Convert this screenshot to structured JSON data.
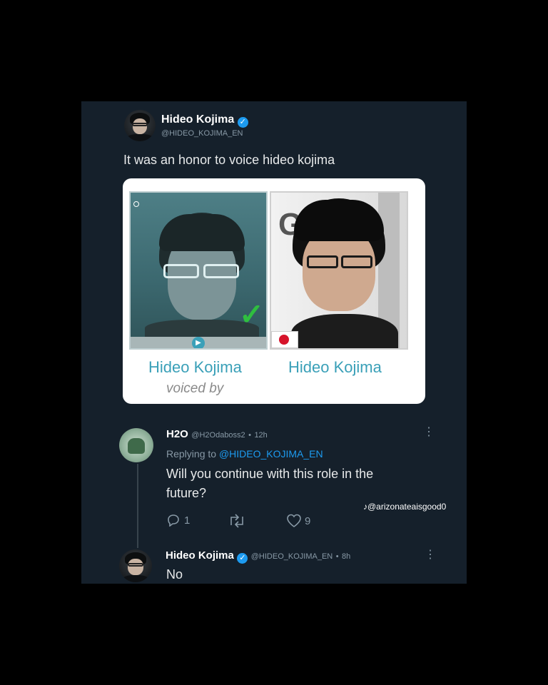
{
  "tweet": {
    "author_name": "Hideo Kojima",
    "author_handle": "@HIDEO_KOJIMA_EN",
    "text": "It was an honor to voice hideo kojima"
  },
  "media_card": {
    "left_label": "Hideo Kojima",
    "right_label": "Hideo Kojima",
    "voiced_by": "voiced by",
    "left_photo_letter": "G"
  },
  "reply": {
    "author_name": "H2O",
    "author_handle": "@H2Odaboss2",
    "time": "12h",
    "replying_to_prefix": "Replying to",
    "replying_to_handle": "@HIDEO_KOJIMA_EN",
    "text_line1": "Will you continue with this role in the",
    "text_line2": "future?",
    "reply_count": "1",
    "like_count": "9"
  },
  "watermark": "@arizonateaisgood0",
  "answer": {
    "author_name": "Hideo Kojima",
    "author_handle": "@HIDEO_KOJIMA_EN",
    "time": "8h",
    "text": "No"
  },
  "icons": {
    "reply": "speech-bubble-icon",
    "retweet": "retweet-icon",
    "like": "heart-icon",
    "verified": "verified-badge-icon",
    "more": "more-dots-icon",
    "tiktok": "tiktok-icon"
  },
  "colors": {
    "background": "#15202b",
    "link": "#1d9bf0",
    "verified": "#1d9bf0",
    "card_label": "#3aa0b8"
  }
}
